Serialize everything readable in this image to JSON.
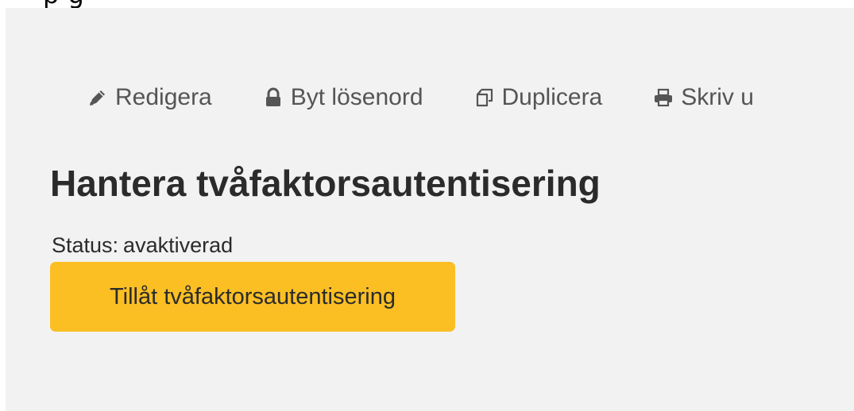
{
  "top_strip_text": "p                                                           g",
  "toolbar": {
    "items": [
      {
        "label": "Redigera",
        "icon": "pencil-icon"
      },
      {
        "label": "Byt lösenord",
        "icon": "lock-icon"
      },
      {
        "label": "Duplicera",
        "icon": "copy-icon"
      },
      {
        "label": "Skriv u",
        "icon": "printer-icon"
      }
    ]
  },
  "page": {
    "title": "Hantera tvåfaktorsautentisering",
    "status_label": "Status:",
    "status_value": "avaktiverad",
    "enable_button_label": "Tillåt tvåfaktorsautentisering"
  },
  "colors": {
    "panel_background": "#f2f2f2",
    "button_accent": "#fbbf24",
    "toolbar_text": "#555555",
    "heading_text": "#2b2b2b"
  }
}
